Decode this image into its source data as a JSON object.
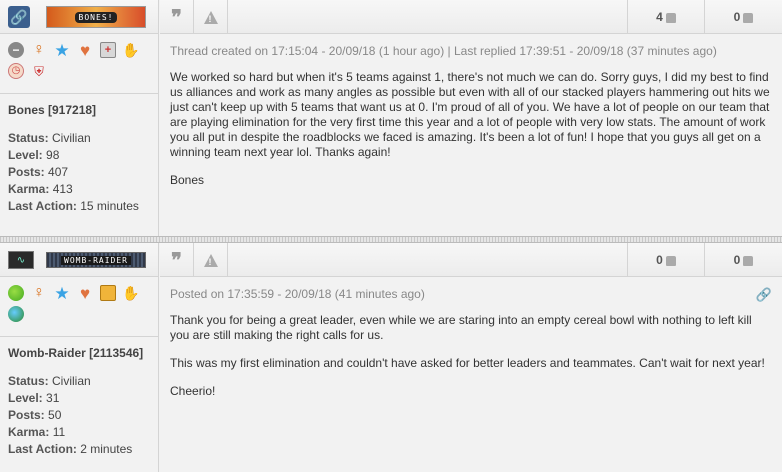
{
  "posts": [
    {
      "faction_badge_text": "BONES!",
      "username": "Bones [917218]",
      "status_label": "Status:",
      "status": "Civilian",
      "level_label": "Level:",
      "level": "98",
      "posts_label": "Posts:",
      "posts": "407",
      "karma_label": "Karma:",
      "karma": "413",
      "last_action_label": "Last Action:",
      "last_action": "15 minutes",
      "likes": "4",
      "dislikes": "0",
      "meta": "Thread created on 17:15:04 - 20/09/18 (1 hour ago) | Last replied 17:39:51 - 20/09/18 (37 minutes ago)",
      "paragraphs": [
        "We worked so hard but when it's 5 teams against 1, there's not much we can do. Sorry guys, I did my best to find us alliances and work as many angles as possible but even with all of our stacked players hammering out hits we just can't keep up with 5 teams that want us at 0. I'm proud of all of you. We have a lot of people on our team that are playing elimination for the very first time this year and a lot of people with very low stats. The amount of work you all put in despite the roadblocks we faced is amazing. It's been a lot of fun! I hope that you guys all get on a winning team next year lol. Thanks again!",
        "Bones"
      ],
      "icons": [
        "minus-icon",
        "female-icon",
        "star-icon",
        "heart-icon",
        "medkit-icon",
        "hand-icon",
        "clock-icon",
        "hospital-bed-icon"
      ]
    },
    {
      "faction_badge_text": "WOMB-RAIDER",
      "username": "Womb-Raider [2113546]",
      "status_label": "Status:",
      "status": "Civilian",
      "level_label": "Level:",
      "level": "31",
      "posts_label": "Posts:",
      "posts": "50",
      "karma_label": "Karma:",
      "karma": "11",
      "last_action_label": "Last Action:",
      "last_action": "2 minutes",
      "likes": "0",
      "dislikes": "0",
      "meta": "Posted on 17:35:59 - 20/09/18 (41 minutes ago)",
      "paragraphs": [
        "Thank you for being a great leader, even while we are staring into an empty cereal bowl with nothing to left kill you are still making the right calls for us.",
        "This was my first elimination and couldn't have asked for better leaders and teammates.  Can't wait for next year!",
        "Cheerio!"
      ],
      "icons": [
        "online-status-icon",
        "female-icon",
        "star-icon",
        "heart-icon",
        "briefcase-icon",
        "hand-icon",
        "globe-icon"
      ]
    }
  ],
  "colors": {
    "background": "#f2f2f2",
    "meta_text": "#888888",
    "body_text": "#333333",
    "border": "#d4d4d4"
  }
}
